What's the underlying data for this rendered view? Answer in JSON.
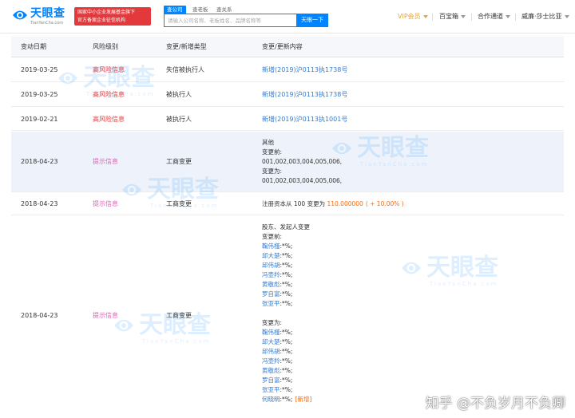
{
  "header": {
    "logo_name": "天眼查",
    "logo_domain": "TianYanCha.com",
    "badge_line1": "国家中小企业发展基金旗下",
    "badge_line2": "官方备案企业征信机构",
    "search_tabs": [
      "查公司",
      "查老板",
      "查关系"
    ],
    "search_placeholder": "请输入公司名称、老板姓名、品牌名称等",
    "search_button": "天眼一下",
    "nav_vip": "VIP会员",
    "nav_treasure": "百宝箱",
    "nav_cooperation": "合作通道",
    "nav_user": "威廉·莎士比亚"
  },
  "table": {
    "columns": [
      "变动日期",
      "风险级别",
      "变更/新增类型",
      "变更/更新内容"
    ],
    "rows": [
      {
        "date": "2019-03-25",
        "level": "高风险信息",
        "type": "失信被执行人",
        "content": [
          "新增(2019)沪0113执1738号"
        ]
      },
      {
        "date": "2019-03-25",
        "level": "高风险信息",
        "type": "被执行人",
        "content": [
          "新增(2019)沪0113执1738号"
        ]
      },
      {
        "date": "2019-02-21",
        "level": "高风险信息",
        "type": "被执行人",
        "content": [
          "新增(2019)沪0113执1001号"
        ]
      },
      {
        "date": "2018-04-23",
        "level": "提示信息",
        "type": "工商变更",
        "content": [
          "其他",
          "变更前:",
          "001,002,003,004,005,006,",
          "变更为:",
          "001,002,003,004,005,006,"
        ]
      },
      {
        "date": "2018-04-23",
        "level": "提示信息",
        "type": "工商变更",
        "content_prefix": "注册资本从 100 变更为 ",
        "content_value": "110.000000",
        "content_change": "( + 10.00% )"
      },
      {
        "date": "2018-04-23",
        "level": "提示信息",
        "type": "工商变更",
        "content_title": "股东、发起人变更",
        "before_label": "变更前:",
        "before": [
          {
            "name": "鞠伟槿",
            "ratio": ":*%;"
          },
          {
            "name": "邱大楚",
            "ratio": ":*%;"
          },
          {
            "name": "邱伟胡",
            "ratio": ":*%;"
          },
          {
            "name": "冯壶羚",
            "ratio": ":*%;"
          },
          {
            "name": "黄敬彪",
            "ratio": ":*%;"
          },
          {
            "name": "罗自富",
            "ratio": ":*%;"
          },
          {
            "name": "张亚平",
            "ratio": ":*%;"
          }
        ],
        "after_label": "变更为:",
        "after": [
          {
            "name": "鞠伟槿",
            "ratio": ":*%;"
          },
          {
            "name": "邱大楚",
            "ratio": ":*%;"
          },
          {
            "name": "邱伟胡",
            "ratio": ":*%;"
          },
          {
            "name": "冯壶羚",
            "ratio": ":*%;"
          },
          {
            "name": "黄敬彪",
            "ratio": ":*%;"
          },
          {
            "name": "罗自富",
            "ratio": ":*%;"
          },
          {
            "name": "张亚平",
            "ratio": ":*%;"
          },
          {
            "name": "何晓明",
            "ratio": ":*%;",
            "tag": "[新增]"
          }
        ]
      }
    ]
  },
  "watermark": {
    "text": "天眼查",
    "sub": "TianYanCha.com"
  },
  "overlay_text": "知乎 @不负岁月不负卿",
  "colors": {
    "brand": "#0084ff",
    "high_risk": "#e4393c",
    "hint": "#e060b8",
    "link": "#2f7cd6",
    "change": "#ff6a00",
    "vip": "#e6a23c"
  }
}
